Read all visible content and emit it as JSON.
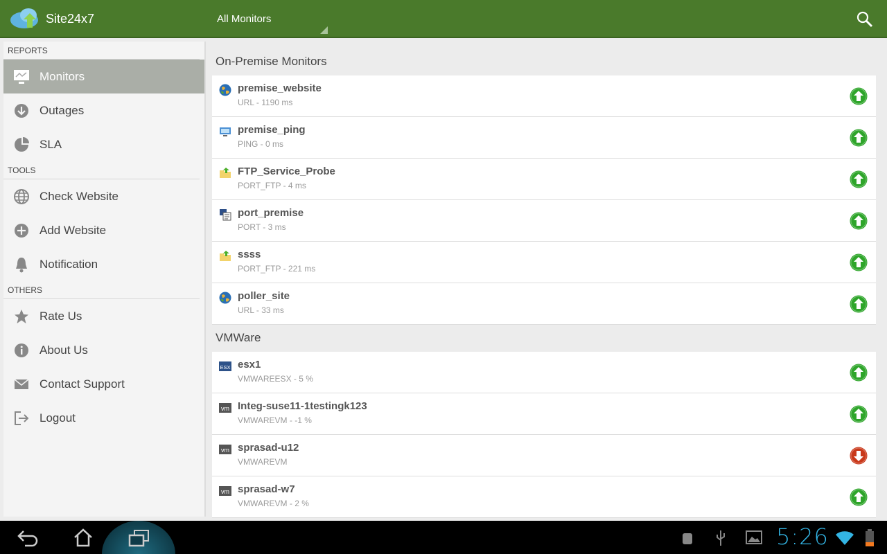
{
  "header": {
    "app_title": "Site24x7",
    "dropdown_value": "All Monitors"
  },
  "sidebar": {
    "sections": [
      {
        "title": "REPORTS",
        "items": [
          {
            "label": "Monitors",
            "icon": "monitor-icon",
            "selected": true
          },
          {
            "label": "Outages",
            "icon": "download-arrow-icon"
          },
          {
            "label": "SLA",
            "icon": "pie-chart-icon"
          }
        ]
      },
      {
        "title": "TOOLS",
        "items": [
          {
            "label": "Check Website",
            "icon": "globe-icon"
          },
          {
            "label": "Add Website",
            "icon": "plus-circle-icon"
          },
          {
            "label": "Notification",
            "icon": "bell-icon"
          }
        ]
      },
      {
        "title": "OTHERS",
        "items": [
          {
            "label": "Rate Us",
            "icon": "star-icon"
          },
          {
            "label": "About Us",
            "icon": "info-icon"
          },
          {
            "label": "Contact Support",
            "icon": "mail-icon"
          },
          {
            "label": "Logout",
            "icon": "logout-icon"
          }
        ]
      }
    ]
  },
  "groups": [
    {
      "title": "On-Premise Monitors",
      "monitors": [
        {
          "name": "premise_website",
          "detail": "URL - 1190 ms",
          "type": "globe",
          "status": "up"
        },
        {
          "name": "premise_ping",
          "detail": "PING - 0 ms",
          "type": "ping",
          "status": "up"
        },
        {
          "name": "FTP_Service_Probe",
          "detail": "PORT_FTP - 4 ms",
          "type": "folder",
          "status": "up"
        },
        {
          "name": "port_premise",
          "detail": "PORT - 3 ms",
          "type": "port",
          "status": "up"
        },
        {
          "name": "ssss",
          "detail": "PORT_FTP - 221 ms",
          "type": "folder",
          "status": "up"
        },
        {
          "name": "poller_site",
          "detail": "URL - 33 ms",
          "type": "globe",
          "status": "up"
        }
      ]
    },
    {
      "title": "VMWare",
      "monitors": [
        {
          "name": "esx1",
          "detail": "VMWAREESX - 5 %",
          "type": "esx",
          "status": "up"
        },
        {
          "name": "Integ-suse11-1testingk123",
          "detail": "VMWAREVM - -1 %",
          "type": "vm",
          "status": "up"
        },
        {
          "name": "sprasad-u12",
          "detail": "VMWAREVM",
          "type": "vm",
          "status": "down"
        },
        {
          "name": "sprasad-w7",
          "detail": "VMWAREVM - 2 %",
          "type": "vm",
          "status": "up"
        }
      ]
    }
  ],
  "type_labels": {
    "esx": "ESX",
    "vm": "vm"
  },
  "colors": {
    "up": "#2ea52a",
    "down": "#c9381a",
    "header": "#4a7a2b"
  },
  "statusbar": {
    "time": "5:26"
  }
}
